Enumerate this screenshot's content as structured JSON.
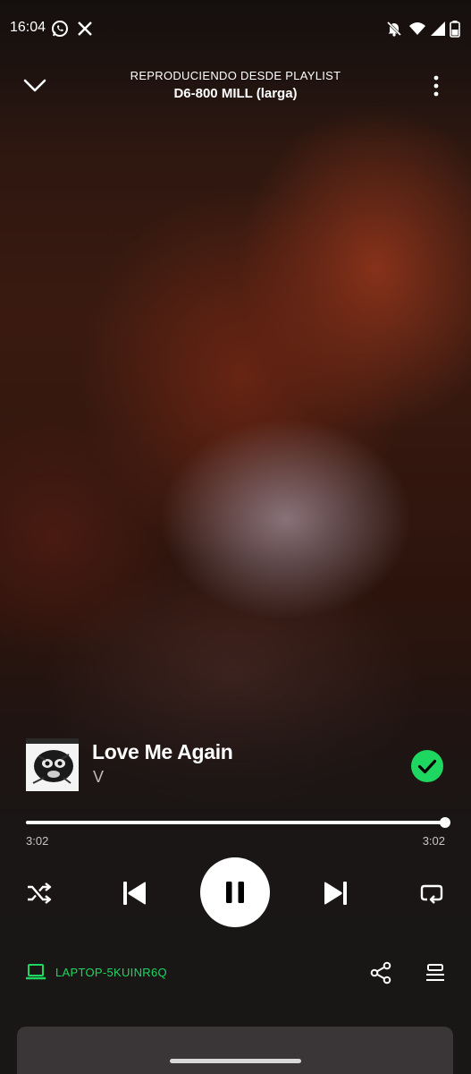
{
  "status_bar": {
    "time": "16:04",
    "left_icons": [
      "whatsapp-icon",
      "x-icon"
    ],
    "right_icons": [
      "notifications-off-icon",
      "wifi-icon",
      "cellular-signal-icon",
      "battery-icon"
    ]
  },
  "header": {
    "eyebrow": "REPRODUCIENDO DESDE PLAYLIST",
    "playlist_name": "D6-800 MILL (larga)",
    "collapse_icon": "chevron-down-icon",
    "more_icon": "more-vertical-icon"
  },
  "track": {
    "title": "Love Me Again",
    "artist": "V",
    "saved": true
  },
  "progress": {
    "elapsed": "3:02",
    "total": "3:02",
    "fraction": 1.0
  },
  "controls": {
    "shuffle_icon": "shuffle-icon",
    "previous_icon": "skip-previous-icon",
    "play_state": "playing",
    "pause_icon": "pause-icon",
    "next_icon": "skip-next-icon",
    "repeat_icon": "repeat-icon"
  },
  "footer": {
    "device_name": "LAPTOP-5KUINR6Q",
    "device_icon": "laptop-icon",
    "share_icon": "share-icon",
    "queue_icon": "queue-icon"
  },
  "colors": {
    "accent": "#1ed760",
    "text": "#ffffff",
    "background": "#2c140d"
  }
}
